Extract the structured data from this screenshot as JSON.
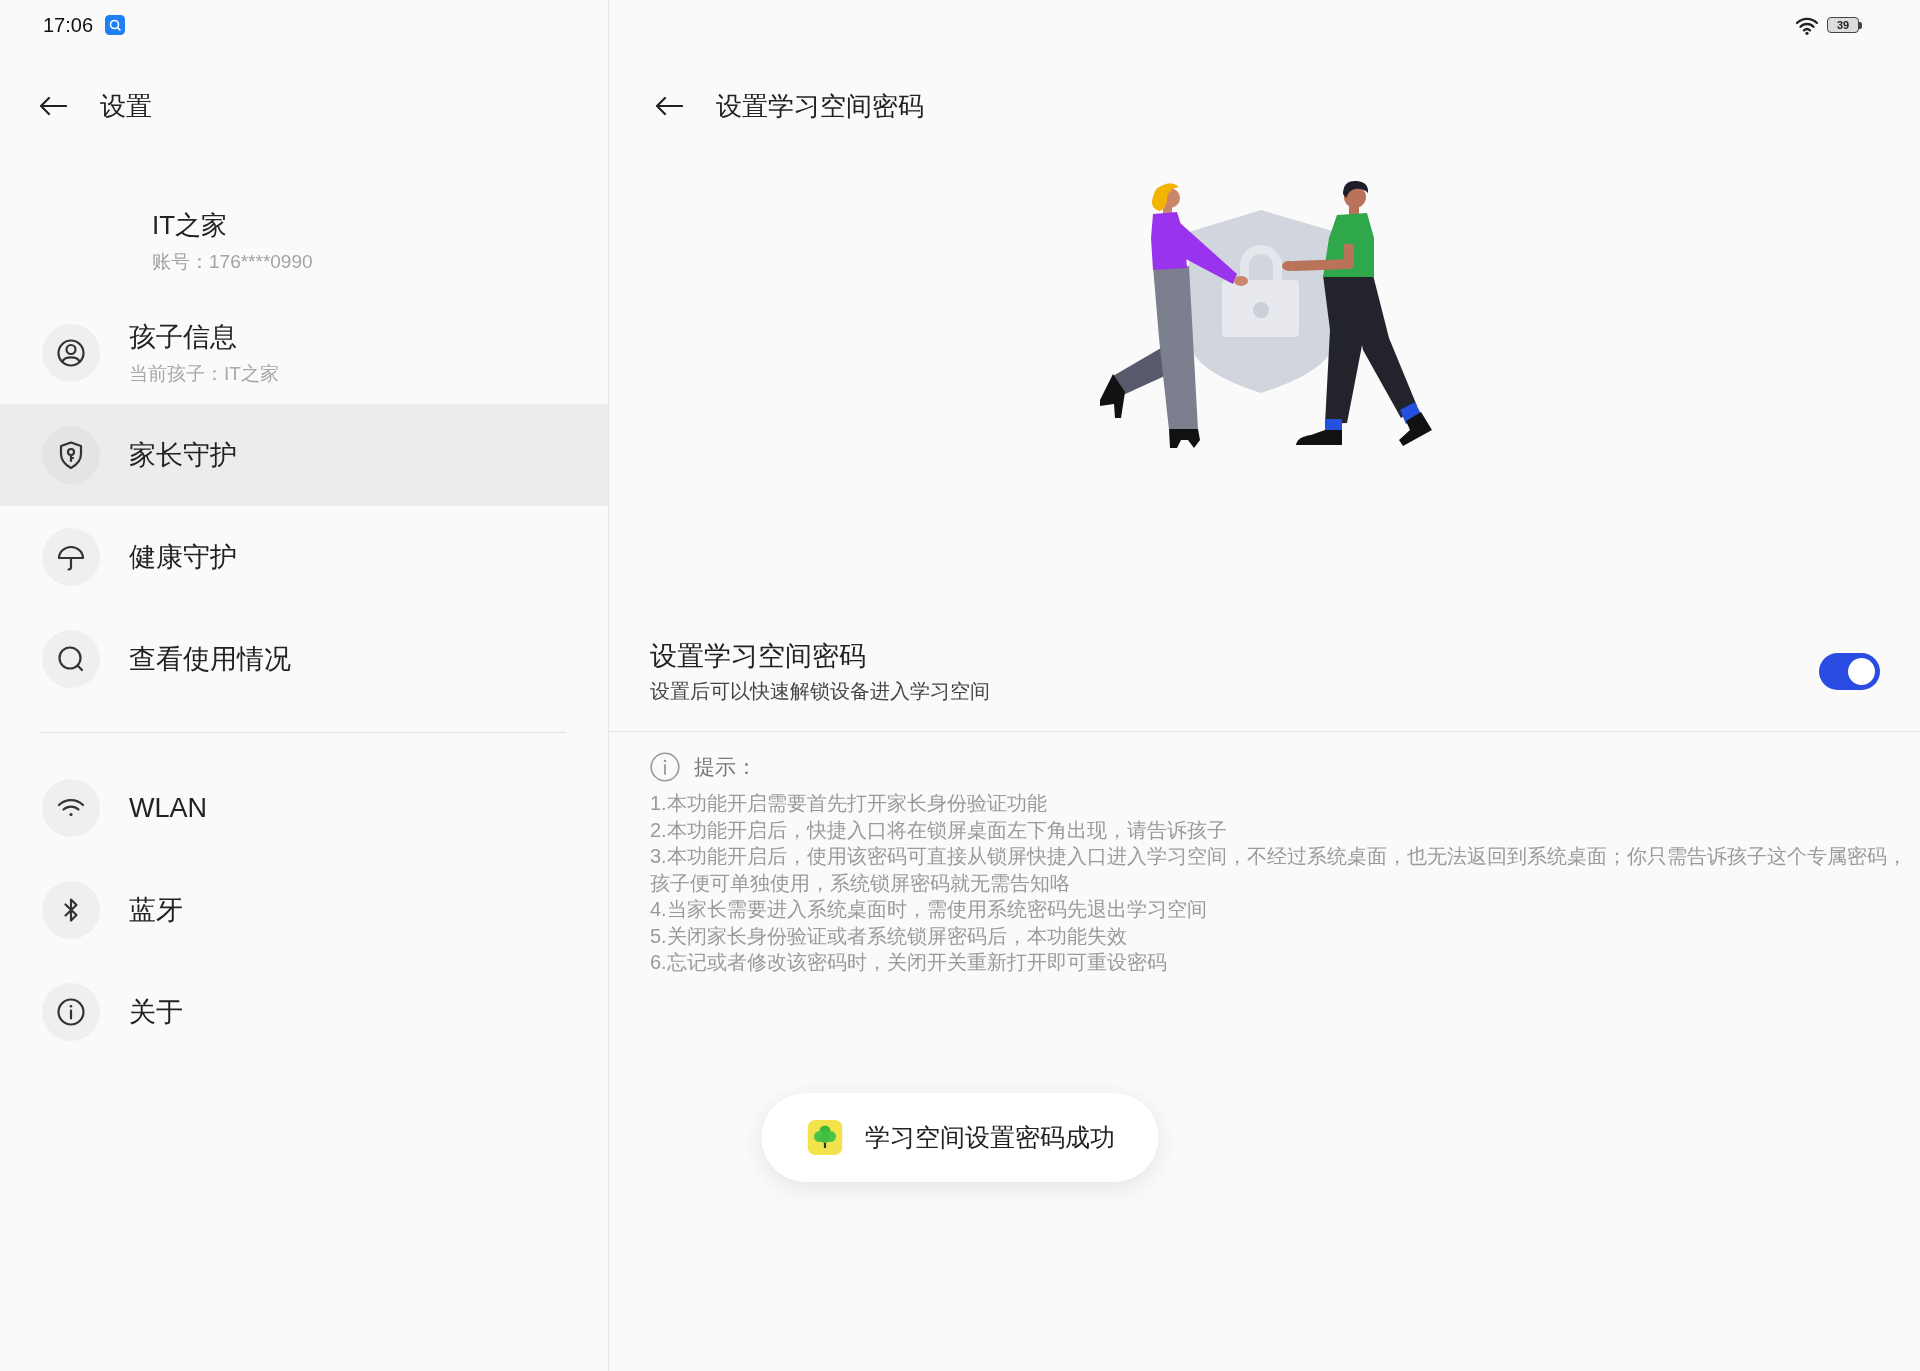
{
  "status_bar": {
    "time": "17:06",
    "battery": "39"
  },
  "sidebar": {
    "title": "设置",
    "account": {
      "name": "IT之家",
      "number": "账号：176****0990"
    },
    "sections": [
      {
        "items": [
          {
            "label": "孩子信息",
            "subtitle": "当前孩子：IT之家",
            "selected": false
          },
          {
            "label": "家长守护",
            "selected": true
          },
          {
            "label": "健康守护",
            "selected": false
          },
          {
            "label": "查看使用情况",
            "selected": false
          }
        ]
      },
      {
        "items": [
          {
            "label": "WLAN",
            "selected": false
          },
          {
            "label": "蓝牙",
            "selected": false
          },
          {
            "label": "关于",
            "selected": false
          }
        ]
      }
    ]
  },
  "main": {
    "title": "设置学习空间密码",
    "setting": {
      "title": "设置学习空间密码",
      "description": "设置后可以快速解锁设备进入学习空间",
      "on": true
    },
    "tips": {
      "heading": "提示：",
      "lines": [
        "1.本功能开启需要首先打开家长身份验证功能",
        "2.本功能开启后，快捷入口将在锁屏桌面左下角出现，请告诉孩子",
        "3.本功能开启后，使用该密码可直接从锁屏快捷入口进入学习空间，不经过系统桌面，也无法返回到系统桌面；你只需告诉孩子这个专属密码，孩子便可单独使用，系统锁屏密码就无需告知咯",
        "4.当家长需要进入系统桌面时，需使用系统密码先退出学习空间",
        "5.关闭家长身份验证或者系统锁屏密码后，本功能失效",
        "6.忘记或者修改该密码时，关闭开关重新打开即可重设密码"
      ]
    }
  },
  "toast": {
    "message": "学习空间设置密码成功"
  }
}
